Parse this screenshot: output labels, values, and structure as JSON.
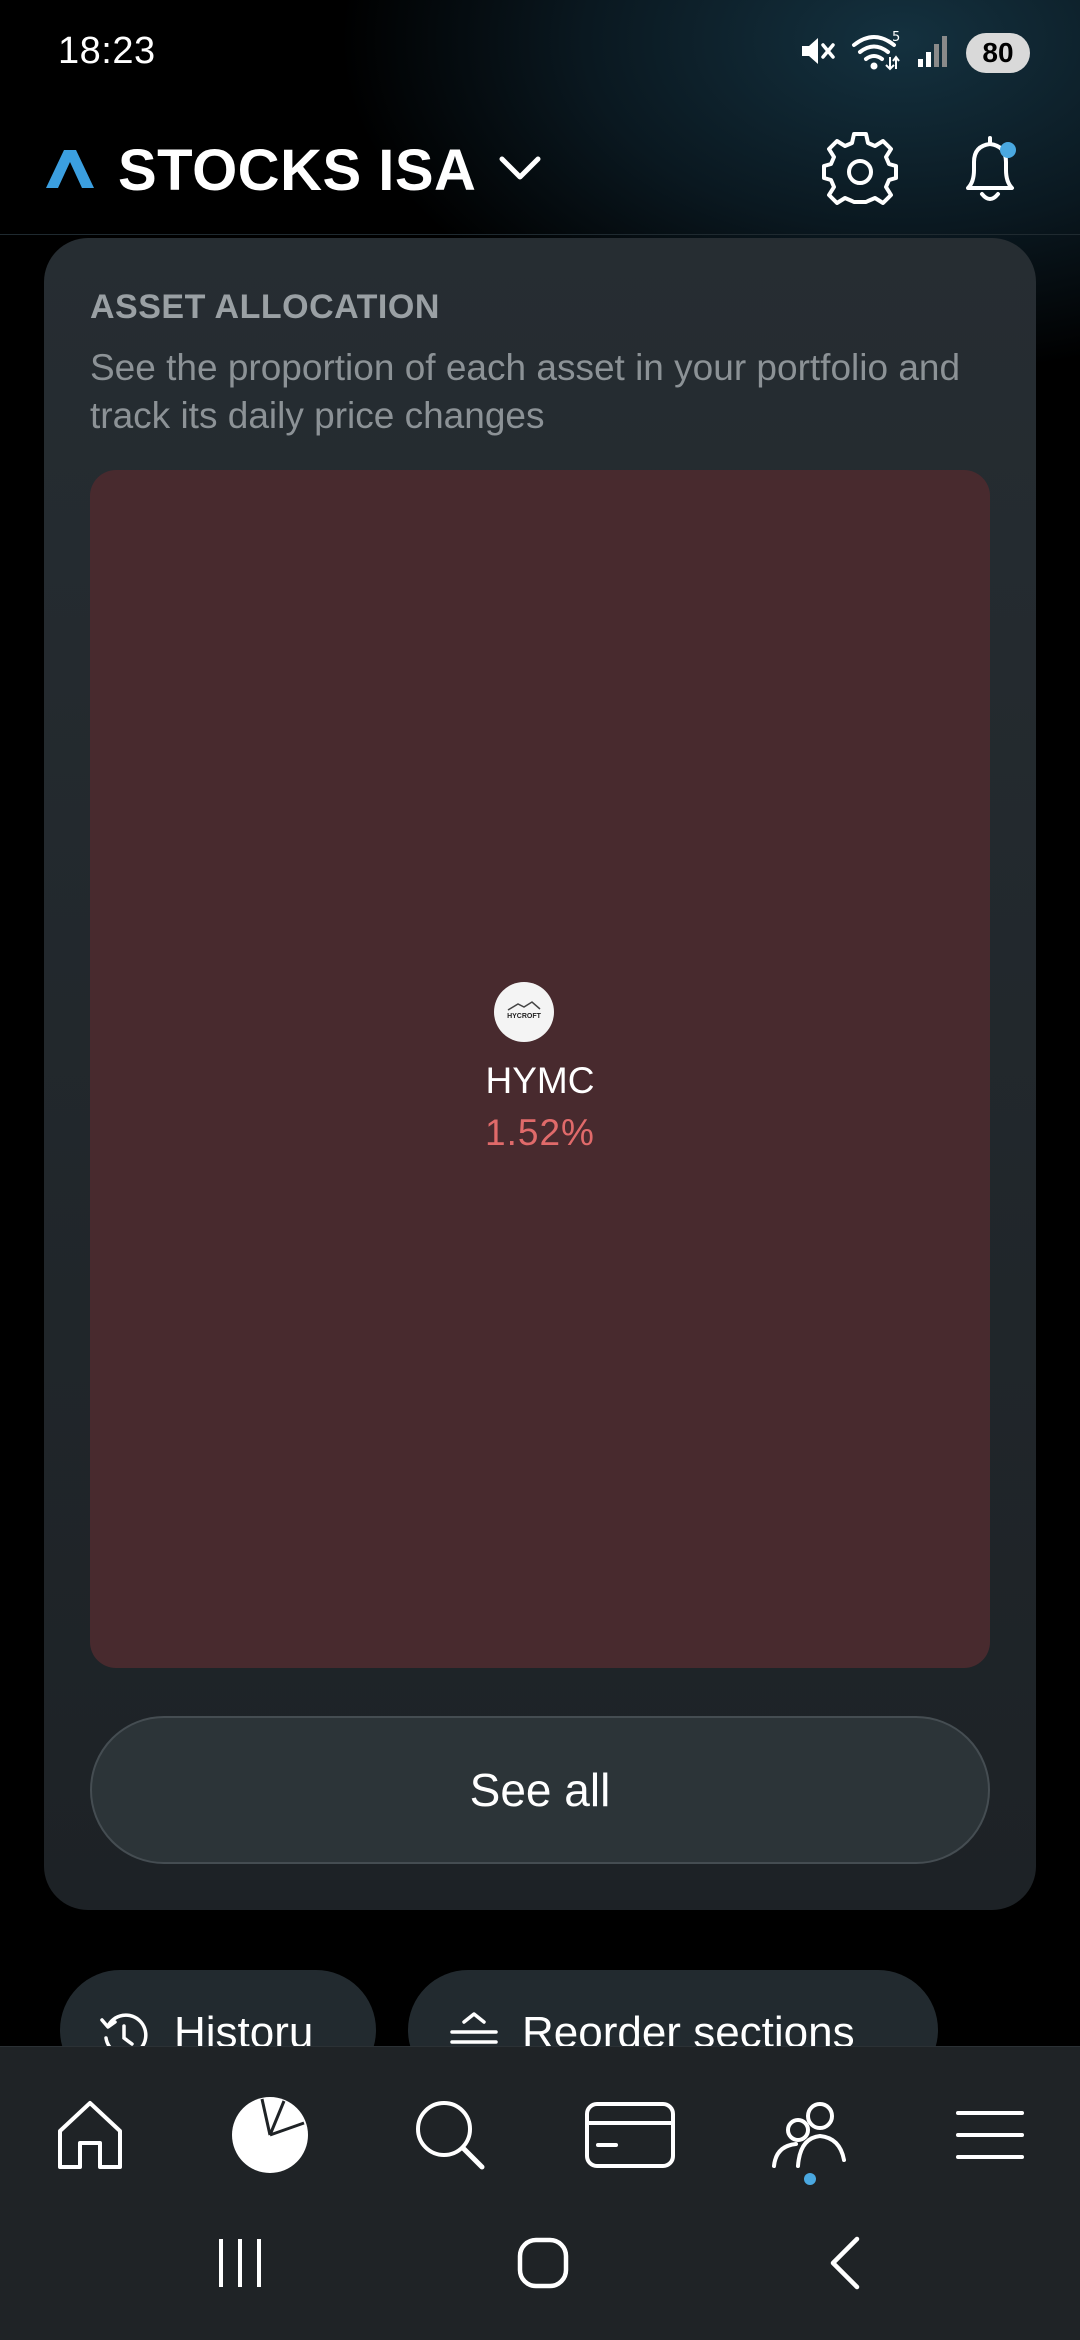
{
  "status_bar": {
    "time": "18:23",
    "battery": "80",
    "wifi_badge": "5"
  },
  "header": {
    "account_name": "STOCKS ISA",
    "brand_color": "#3b9fe0",
    "notification_dot_color": "#4aa8e0"
  },
  "allocation": {
    "title": "ASSET ALLOCATION",
    "description": "See the proportion of each asset in your portfolio and track its daily price changes",
    "holdings": [
      {
        "ticker": "HYMC",
        "logo_text": "HYCROFT",
        "daily_change": "1.52%",
        "change_color": "#e06a6a",
        "tile_color": "#482a2e"
      }
    ],
    "see_all_label": "See all"
  },
  "quick_actions": {
    "history_label": "Historu",
    "reorder_label": "Reorder sections"
  },
  "bottom_nav": {
    "items": [
      {
        "id": "home",
        "icon": "home-icon"
      },
      {
        "id": "portfolio",
        "icon": "pie-chart-icon",
        "active": true
      },
      {
        "id": "search",
        "icon": "search-icon"
      },
      {
        "id": "card",
        "icon": "card-icon"
      },
      {
        "id": "social",
        "icon": "people-icon",
        "has_dot": true
      },
      {
        "id": "menu",
        "icon": "menu-icon"
      }
    ]
  },
  "system_nav": {
    "items": [
      "recents-icon",
      "home-circle-icon",
      "back-icon"
    ]
  }
}
